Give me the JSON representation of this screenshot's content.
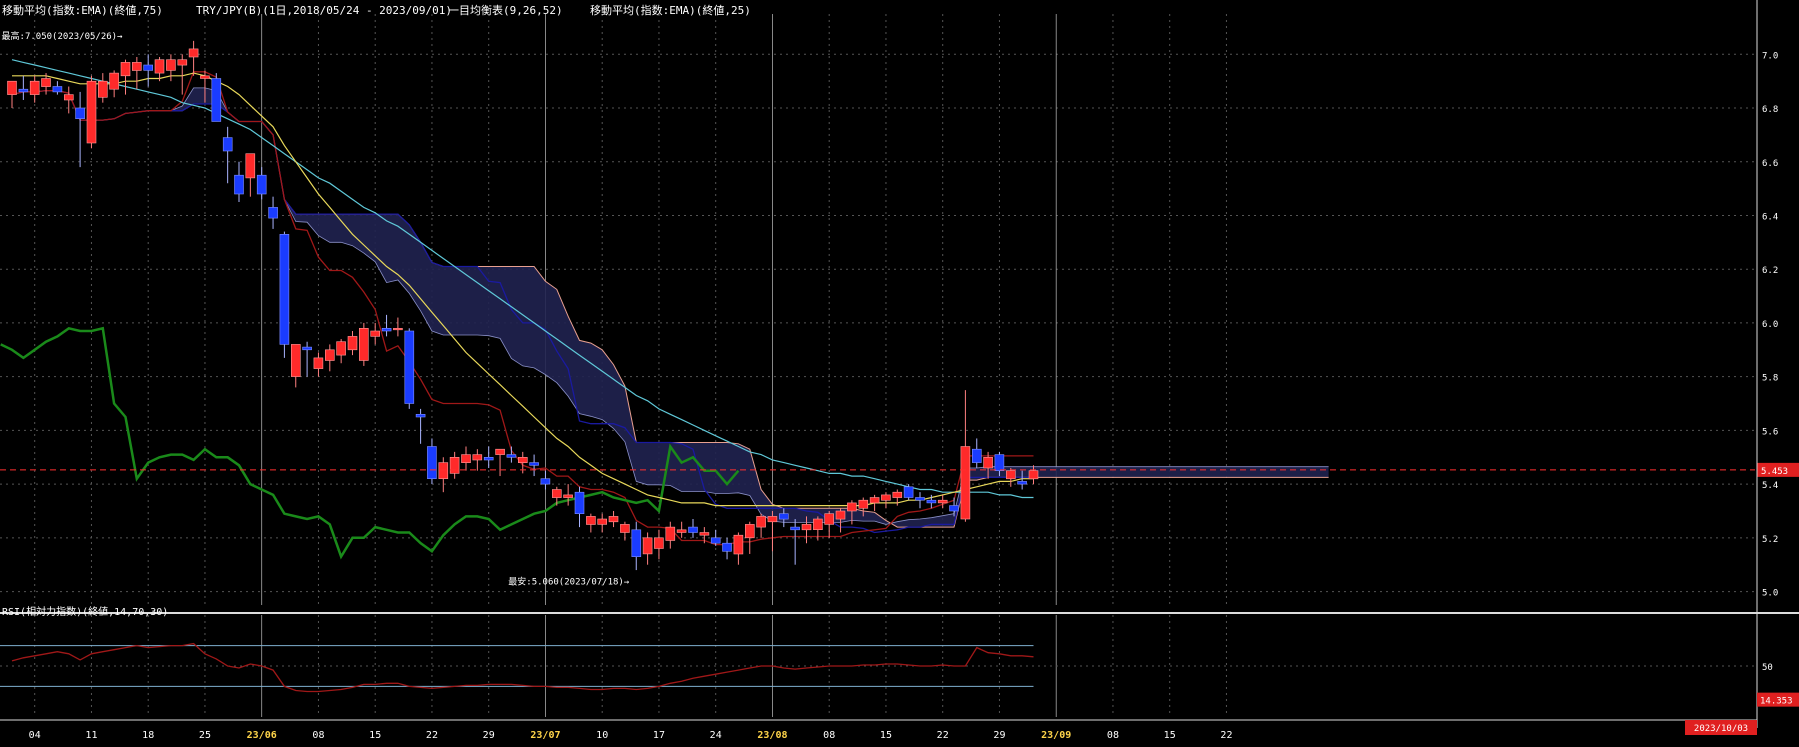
{
  "header": {
    "ema75_label": "移動平均(指数:EMA)(終値,75)",
    "pair_label": "TRY/JPY(B)(1日,2018/05/24 - 2023/09/01)",
    "ichimoku_label": "一目均衡表(9,26,52)",
    "ema25_label": "移動平均(指数:EMA)(終値,25)"
  },
  "annotations": {
    "high": "最高:7.050(2023/05/26)→",
    "low": "最安:5.060(2023/07/18)→",
    "last_price": "5.453",
    "rsi_last": "14.353",
    "date_last": "2023/10/03"
  },
  "rsi_panel": {
    "label": "RSI(相対力指数)(終値,14,70,30)"
  },
  "colors": {
    "up": "#ff2a2a",
    "down": "#1a3cff",
    "cloud": "#202250",
    "ema75": "#5fc8d8",
    "ema25": "#e8d85a",
    "kijun": "#1a1aa0",
    "tenkan": "#a01818",
    "chikou": "#1a8a1a",
    "spanB": "#e8a090",
    "rsi_line": "#a01818",
    "price_line": "#ff3030"
  },
  "chart_data": [
    {
      "type": "candlestick",
      "title": "TRY/JPY(B)(1日,2018/05/24 - 2023/09/01)",
      "ylim": [
        4.95,
        7.15
      ],
      "y_ticks": [
        "7.0",
        "6.8",
        "6.6",
        "6.4",
        "6.2",
        "6.0",
        "5.8",
        "5.6",
        "5.4",
        "5.2",
        "5.0"
      ],
      "x_ticks": [
        {
          "label": "04",
          "major": false
        },
        {
          "label": "11",
          "major": false
        },
        {
          "label": "18",
          "major": false
        },
        {
          "label": "25",
          "major": false
        },
        {
          "label": "23/06",
          "major": true
        },
        {
          "label": "08",
          "major": false
        },
        {
          "label": "15",
          "major": false
        },
        {
          "label": "22",
          "major": false
        },
        {
          "label": "29",
          "major": false
        },
        {
          "label": "23/07",
          "major": true
        },
        {
          "label": "10",
          "major": false
        },
        {
          "label": "17",
          "major": false
        },
        {
          "label": "24",
          "major": false
        },
        {
          "label": "23/08",
          "major": true
        },
        {
          "label": "08",
          "major": false
        },
        {
          "label": "15",
          "major": false
        },
        {
          "label": "22",
          "major": false
        },
        {
          "label": "29",
          "major": false
        },
        {
          "label": "23/09",
          "major": true
        },
        {
          "label": "08",
          "major": false
        },
        {
          "label": "15",
          "major": false
        },
        {
          "label": "22",
          "major": false
        }
      ],
      "candles": [
        {
          "o": 6.85,
          "h": 6.9,
          "l": 6.8,
          "c": 6.9
        },
        {
          "o": 6.87,
          "h": 6.92,
          "l": 6.83,
          "c": 6.86
        },
        {
          "o": 6.85,
          "h": 6.92,
          "l": 6.82,
          "c": 6.9
        },
        {
          "o": 6.88,
          "h": 6.93,
          "l": 6.85,
          "c": 6.91
        },
        {
          "o": 6.88,
          "h": 6.9,
          "l": 6.85,
          "c": 6.86
        },
        {
          "o": 6.83,
          "h": 6.88,
          "l": 6.78,
          "c": 6.85
        },
        {
          "o": 6.8,
          "h": 6.86,
          "l": 6.58,
          "c": 6.76
        },
        {
          "o": 6.67,
          "h": 6.92,
          "l": 6.65,
          "c": 6.9
        },
        {
          "o": 6.84,
          "h": 6.93,
          "l": 6.82,
          "c": 6.9
        },
        {
          "o": 6.87,
          "h": 6.94,
          "l": 6.84,
          "c": 6.93
        },
        {
          "o": 6.92,
          "h": 6.98,
          "l": 6.85,
          "c": 6.97
        },
        {
          "o": 6.94,
          "h": 6.99,
          "l": 6.87,
          "c": 6.97
        },
        {
          "o": 6.96,
          "h": 7.0,
          "l": 6.88,
          "c": 6.94
        },
        {
          "o": 6.93,
          "h": 6.99,
          "l": 6.9,
          "c": 6.98
        },
        {
          "o": 6.94,
          "h": 7.0,
          "l": 6.9,
          "c": 6.98
        },
        {
          "o": 6.96,
          "h": 7.0,
          "l": 6.85,
          "c": 6.98
        },
        {
          "o": 6.99,
          "h": 7.05,
          "l": 6.92,
          "c": 7.02
        },
        {
          "o": 6.91,
          "h": 6.94,
          "l": 6.82,
          "c": 6.92
        },
        {
          "o": 6.91,
          "h": 6.93,
          "l": 6.78,
          "c": 6.75
        },
        {
          "o": 6.69,
          "h": 6.73,
          "l": 6.52,
          "c": 6.64
        },
        {
          "o": 6.55,
          "h": 6.6,
          "l": 6.45,
          "c": 6.48
        },
        {
          "o": 6.54,
          "h": 6.63,
          "l": 6.47,
          "c": 6.63
        },
        {
          "o": 6.55,
          "h": 6.58,
          "l": 6.46,
          "c": 6.48
        },
        {
          "o": 6.43,
          "h": 6.47,
          "l": 6.35,
          "c": 6.39
        },
        {
          "o": 6.33,
          "h": 6.34,
          "l": 5.87,
          "c": 5.92
        },
        {
          "o": 5.8,
          "h": 5.9,
          "l": 5.76,
          "c": 5.92
        },
        {
          "o": 5.91,
          "h": 5.93,
          "l": 5.8,
          "c": 5.9
        },
        {
          "o": 5.83,
          "h": 5.89,
          "l": 5.8,
          "c": 5.87
        },
        {
          "o": 5.86,
          "h": 5.92,
          "l": 5.82,
          "c": 5.9
        },
        {
          "o": 5.88,
          "h": 5.94,
          "l": 5.85,
          "c": 5.93
        },
        {
          "o": 5.9,
          "h": 5.97,
          "l": 5.88,
          "c": 5.95
        },
        {
          "o": 5.86,
          "h": 6.0,
          "l": 5.84,
          "c": 5.98
        },
        {
          "o": 5.95,
          "h": 6.0,
          "l": 5.92,
          "c": 5.97
        },
        {
          "o": 5.98,
          "h": 6.03,
          "l": 5.95,
          "c": 5.97
        },
        {
          "o": 5.98,
          "h": 6.02,
          "l": 5.95,
          "c": 5.98
        },
        {
          "o": 5.97,
          "h": 5.98,
          "l": 5.68,
          "c": 5.7
        },
        {
          "o": 5.66,
          "h": 5.68,
          "l": 5.55,
          "c": 5.65
        },
        {
          "o": 5.54,
          "h": 5.57,
          "l": 5.4,
          "c": 5.42
        },
        {
          "o": 5.42,
          "h": 5.5,
          "l": 5.37,
          "c": 5.48
        },
        {
          "o": 5.44,
          "h": 5.52,
          "l": 5.42,
          "c": 5.5
        },
        {
          "o": 5.48,
          "h": 5.54,
          "l": 5.45,
          "c": 5.51
        },
        {
          "o": 5.49,
          "h": 5.53,
          "l": 5.45,
          "c": 5.51
        },
        {
          "o": 5.5,
          "h": 5.54,
          "l": 5.46,
          "c": 5.49
        },
        {
          "o": 5.51,
          "h": 5.53,
          "l": 5.43,
          "c": 5.53
        },
        {
          "o": 5.51,
          "h": 5.54,
          "l": 5.48,
          "c": 5.5
        },
        {
          "o": 5.48,
          "h": 5.52,
          "l": 5.44,
          "c": 5.5
        },
        {
          "o": 5.48,
          "h": 5.51,
          "l": 5.43,
          "c": 5.47
        },
        {
          "o": 5.42,
          "h": 5.45,
          "l": 5.38,
          "c": 5.4
        },
        {
          "o": 5.35,
          "h": 5.39,
          "l": 5.32,
          "c": 5.38
        },
        {
          "o": 5.35,
          "h": 5.4,
          "l": 5.32,
          "c": 5.36
        },
        {
          "o": 5.37,
          "h": 5.39,
          "l": 5.24,
          "c": 5.29
        },
        {
          "o": 5.25,
          "h": 5.29,
          "l": 5.22,
          "c": 5.28
        },
        {
          "o": 5.25,
          "h": 5.29,
          "l": 5.22,
          "c": 5.27
        },
        {
          "o": 5.26,
          "h": 5.3,
          "l": 5.24,
          "c": 5.28
        },
        {
          "o": 5.22,
          "h": 5.26,
          "l": 5.19,
          "c": 5.25
        },
        {
          "o": 5.23,
          "h": 5.26,
          "l": 5.08,
          "c": 5.13
        },
        {
          "o": 5.14,
          "h": 5.22,
          "l": 5.1,
          "c": 5.2
        },
        {
          "o": 5.16,
          "h": 5.23,
          "l": 5.12,
          "c": 5.2
        },
        {
          "o": 5.19,
          "h": 5.26,
          "l": 5.16,
          "c": 5.24
        },
        {
          "o": 5.22,
          "h": 5.26,
          "l": 5.2,
          "c": 5.23
        },
        {
          "o": 5.24,
          "h": 5.27,
          "l": 5.2,
          "c": 5.22
        },
        {
          "o": 5.21,
          "h": 5.24,
          "l": 5.18,
          "c": 5.22
        },
        {
          "o": 5.2,
          "h": 5.23,
          "l": 5.17,
          "c": 5.18
        },
        {
          "o": 5.18,
          "h": 5.2,
          "l": 5.12,
          "c": 5.15
        },
        {
          "o": 5.14,
          "h": 5.22,
          "l": 5.1,
          "c": 5.21
        },
        {
          "o": 5.2,
          "h": 5.26,
          "l": 5.14,
          "c": 5.25
        },
        {
          "o": 5.24,
          "h": 5.29,
          "l": 5.2,
          "c": 5.28
        },
        {
          "o": 5.26,
          "h": 5.3,
          "l": 5.15,
          "c": 5.28
        },
        {
          "o": 5.29,
          "h": 5.31,
          "l": 5.24,
          "c": 5.27
        },
        {
          "o": 5.24,
          "h": 5.27,
          "l": 5.1,
          "c": 5.23
        },
        {
          "o": 5.23,
          "h": 5.28,
          "l": 5.18,
          "c": 5.25
        },
        {
          "o": 5.23,
          "h": 5.28,
          "l": 5.19,
          "c": 5.27
        },
        {
          "o": 5.25,
          "h": 5.3,
          "l": 5.2,
          "c": 5.29
        },
        {
          "o": 5.27,
          "h": 5.31,
          "l": 5.22,
          "c": 5.3
        },
        {
          "o": 5.3,
          "h": 5.34,
          "l": 5.25,
          "c": 5.33
        },
        {
          "o": 5.31,
          "h": 5.35,
          "l": 5.28,
          "c": 5.34
        },
        {
          "o": 5.33,
          "h": 5.36,
          "l": 5.3,
          "c": 5.35
        },
        {
          "o": 5.34,
          "h": 5.37,
          "l": 5.31,
          "c": 5.36
        },
        {
          "o": 5.35,
          "h": 5.38,
          "l": 5.32,
          "c": 5.37
        },
        {
          "o": 5.39,
          "h": 5.4,
          "l": 5.34,
          "c": 5.35
        },
        {
          "o": 5.35,
          "h": 5.37,
          "l": 5.31,
          "c": 5.34
        },
        {
          "o": 5.34,
          "h": 5.36,
          "l": 5.31,
          "c": 5.33
        },
        {
          "o": 5.33,
          "h": 5.36,
          "l": 5.31,
          "c": 5.34
        },
        {
          "o": 5.32,
          "h": 5.35,
          "l": 5.28,
          "c": 5.3
        },
        {
          "o": 5.27,
          "h": 5.75,
          "l": 5.26,
          "c": 5.54
        },
        {
          "o": 5.53,
          "h": 5.57,
          "l": 5.46,
          "c": 5.48
        },
        {
          "o": 5.46,
          "h": 5.52,
          "l": 5.42,
          "c": 5.5
        },
        {
          "o": 5.51,
          "h": 5.52,
          "l": 5.43,
          "c": 5.45
        },
        {
          "o": 5.42,
          "h": 5.46,
          "l": 5.39,
          "c": 5.45
        },
        {
          "o": 5.41,
          "h": 5.45,
          "l": 5.38,
          "c": 5.4
        },
        {
          "o": 5.42,
          "h": 5.47,
          "l": 5.4,
          "c": 5.45
        }
      ],
      "ema75": [
        6.98,
        6.97,
        6.96,
        6.95,
        6.94,
        6.93,
        6.92,
        6.91,
        6.9,
        6.89,
        6.88,
        6.87,
        6.86,
        6.85,
        6.84,
        6.82,
        6.81,
        6.8,
        6.78,
        6.76,
        6.74,
        6.72,
        6.69,
        6.66,
        6.63,
        6.6,
        6.57,
        6.54,
        6.52,
        6.49,
        6.46,
        6.43,
        6.41,
        6.38,
        6.36,
        6.33,
        6.3,
        6.27,
        6.24,
        6.21,
        6.18,
        6.15,
        6.12,
        6.09,
        6.06,
        6.03,
        6.0,
        5.97,
        5.94,
        5.91,
        5.88,
        5.85,
        5.82,
        5.79,
        5.76,
        5.73,
        5.71,
        5.68,
        5.66,
        5.64,
        5.62,
        5.6,
        5.58,
        5.56,
        5.54,
        5.52,
        5.51,
        5.49,
        5.48,
        5.47,
        5.46,
        5.45,
        5.44,
        5.44,
        5.43,
        5.43,
        5.42,
        5.41,
        5.4,
        5.39,
        5.38,
        5.38,
        5.37,
        5.37,
        5.37,
        5.37,
        5.37,
        5.36,
        5.36,
        5.35,
        5.35
      ],
      "ema25": [
        6.92,
        6.92,
        6.92,
        6.92,
        6.91,
        6.9,
        6.89,
        6.89,
        6.89,
        6.89,
        6.9,
        6.9,
        6.91,
        6.91,
        6.92,
        6.92,
        6.93,
        6.92,
        6.9,
        6.88,
        6.85,
        6.81,
        6.77,
        6.73,
        6.66,
        6.6,
        6.54,
        6.48,
        6.43,
        6.38,
        6.33,
        6.29,
        6.25,
        6.21,
        6.18,
        6.14,
        6.09,
        6.04,
        5.99,
        5.94,
        5.89,
        5.85,
        5.81,
        5.77,
        5.73,
        5.69,
        5.65,
        5.61,
        5.57,
        5.54,
        5.5,
        5.47,
        5.44,
        5.42,
        5.4,
        5.38,
        5.36,
        5.35,
        5.34,
        5.33,
        5.33,
        5.33,
        5.32,
        5.32,
        5.32,
        5.32,
        5.32,
        5.32,
        5.32,
        5.32,
        5.32,
        5.32,
        5.32,
        5.32,
        5.32,
        5.32,
        5.33,
        5.33,
        5.33,
        5.34,
        5.34,
        5.35,
        5.36,
        5.37,
        5.38,
        5.39,
        5.4,
        5.41,
        5.41,
        5.42,
        5.42
      ]
    },
    {
      "type": "line",
      "title": "RSI(相対力指数)(終値,14,70,30)",
      "ylim": [
        0,
        100
      ],
      "y_ticks": [
        "50"
      ],
      "levels": [
        70,
        30
      ],
      "values": [
        55,
        58,
        60,
        62,
        64,
        62,
        56,
        62,
        64,
        66,
        68,
        70,
        68,
        69,
        70,
        70,
        72,
        62,
        57,
        50,
        48,
        52,
        50,
        46,
        30,
        26,
        25,
        25,
        26,
        27,
        29,
        32,
        32,
        33,
        33,
        30,
        29,
        28,
        29,
        30,
        31,
        31,
        32,
        32,
        32,
        31,
        30,
        30,
        29,
        29,
        28,
        27,
        27,
        28,
        28,
        27,
        28,
        30,
        33,
        35,
        38,
        40,
        42,
        44,
        46,
        48,
        50,
        50,
        48,
        47,
        48,
        49,
        50,
        50,
        50,
        51,
        51,
        52,
        52,
        51,
        50,
        50,
        51,
        50,
        50,
        68,
        63,
        62,
        60,
        60,
        59
      ]
    }
  ]
}
